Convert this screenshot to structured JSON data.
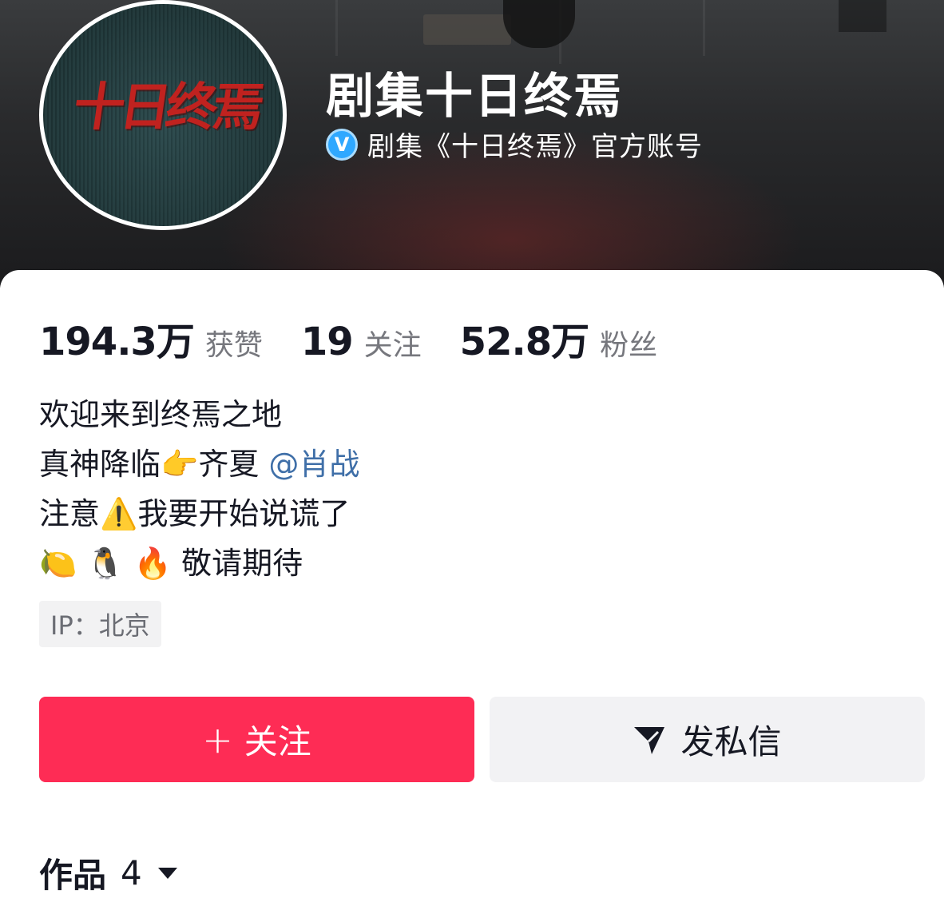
{
  "profile": {
    "display_name": "剧集十日终焉",
    "verified_text": "剧集《十日终焉》官方账号",
    "verified_icon": "V",
    "avatar_text": "十日终焉"
  },
  "stats": [
    {
      "value": "194.3万",
      "label": "获赞"
    },
    {
      "value": "19",
      "label": "关注"
    },
    {
      "value": "52.8万",
      "label": "粉丝"
    }
  ],
  "bio": {
    "line1": "欢迎来到终焉之地",
    "line2_text": "真神降临👉齐夏 ",
    "line2_mention": "@肖战",
    "line3": "注意⚠️我要开始说谎了",
    "line4": "🍋 🐧 🔥  敬请期待"
  },
  "ip": "IP：北京",
  "buttons": {
    "follow_plus": "+",
    "follow_label": "关注",
    "message_label": "发私信"
  },
  "works": {
    "label": "作品",
    "count": "4"
  },
  "colors": {
    "accent": "#fe2c55",
    "mention": "#3f6fa8",
    "verified": "#2fa8ff"
  }
}
